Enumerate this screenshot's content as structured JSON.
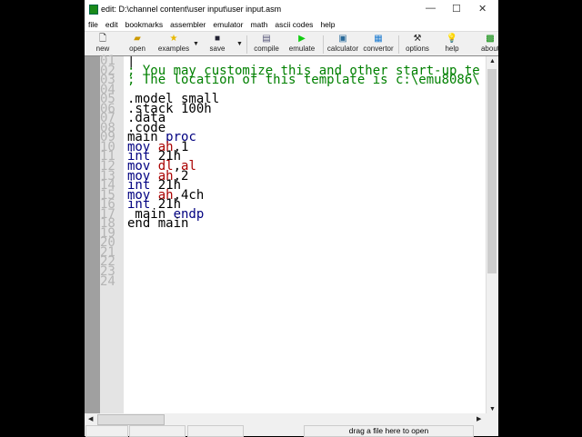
{
  "window": {
    "title": "edit: D:\\channel content\\user input\\user input.asm"
  },
  "menu": [
    "file",
    "edit",
    "bookmarks",
    "assembler",
    "emulator",
    "math",
    "ascii codes",
    "help"
  ],
  "toolbar": {
    "new": "new",
    "open": "open",
    "examples": "examples",
    "save": "save",
    "compile": "compile",
    "emulate": "emulate",
    "calculator": "calculator",
    "convertor": "convertor",
    "options": "options",
    "help": "help",
    "about": "about"
  },
  "colors": {
    "comment": "#008000",
    "keyword": "#000080",
    "register": "#aa0000",
    "text": "#000000"
  },
  "line_numbers": "01\n02\n03\n04\n05\n06\n07\n08\n09\n10\n11\n12\n13\n14\n15\n16\n17\n18\n19\n20\n21\n22\n23\n24",
  "code": [
    [],
    [
      [
        "c",
        "; You may customize this and other start-up te"
      ]
    ],
    [
      [
        "c",
        "; The location of this template is c:\\emu8086\\"
      ]
    ],
    [],
    [
      [
        "t",
        ".model small"
      ]
    ],
    [
      [
        "t",
        ".stack 100h"
      ]
    ],
    [
      [
        "t",
        ".data"
      ]
    ],
    [
      [
        "t",
        ".code"
      ]
    ],
    [
      [
        "t",
        "main "
      ],
      [
        "k",
        "proc"
      ]
    ],
    [
      [
        "k",
        "mov "
      ],
      [
        "r",
        "ah"
      ],
      [
        "t",
        ",1"
      ]
    ],
    [
      [
        "k",
        "int "
      ],
      [
        "t",
        "21h"
      ]
    ],
    [
      [
        "k",
        "mov "
      ],
      [
        "r",
        "dl"
      ],
      [
        "t",
        ","
      ],
      [
        "r",
        "al"
      ]
    ],
    [
      [
        "k",
        "mov "
      ],
      [
        "r",
        "ah"
      ],
      [
        "t",
        ",2"
      ]
    ],
    [
      [
        "k",
        "int "
      ],
      [
        "t",
        "21h"
      ]
    ],
    [
      [
        "k",
        "mov "
      ],
      [
        "r",
        "ah"
      ],
      [
        "t",
        ",4ch"
      ]
    ],
    [
      [
        "k",
        "int "
      ],
      [
        "t",
        "21h"
      ]
    ],
    [
      [
        "t",
        " main "
      ],
      [
        "k",
        "endp"
      ]
    ],
    [
      [
        "t",
        "end main"
      ]
    ]
  ],
  "status": {
    "hint": "drag a file here to open"
  }
}
